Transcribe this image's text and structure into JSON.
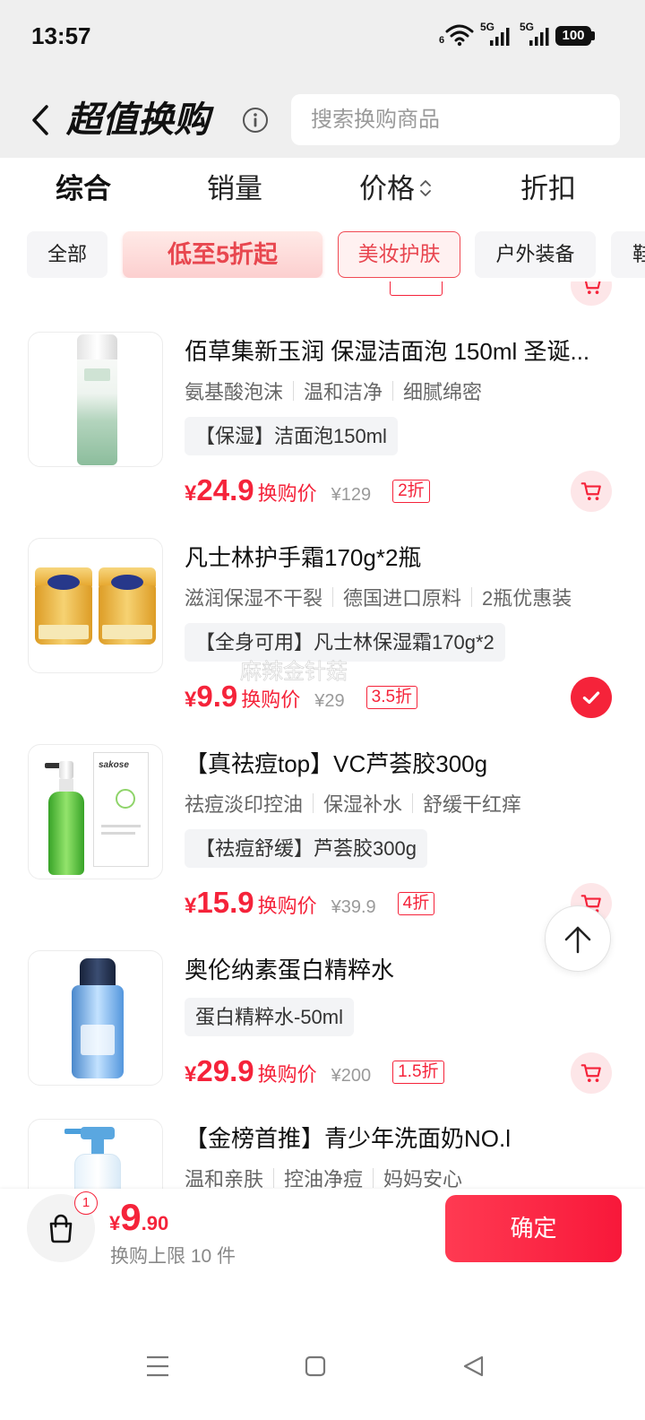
{
  "status_bar": {
    "time": "13:57",
    "wifi_label": "6",
    "signal_1_label": "5G",
    "signal_2_label": "5G",
    "battery": "100"
  },
  "header": {
    "title": "超值换购",
    "search_placeholder": "搜索换购商品"
  },
  "sort_tabs": [
    {
      "label": "综合",
      "active": true
    },
    {
      "label": "销量",
      "active": false
    },
    {
      "label": "价格",
      "active": false,
      "sortable": true
    },
    {
      "label": "折扣",
      "active": false
    }
  ],
  "filter_chips": [
    {
      "label": "全部",
      "selected": false
    },
    {
      "label": "低至5折起",
      "promo": true
    },
    {
      "label": "美妆护肤",
      "selected": true
    },
    {
      "label": "户外装备",
      "selected": false
    },
    {
      "label": "鞋",
      "selected": false
    }
  ],
  "currency": "¥",
  "price_label": "换购价",
  "products": [
    {
      "title": "佰草集新玉润 保湿洁面泡 150ml 圣诞...",
      "tags": [
        "氨基酸泡沫",
        "温和洁净",
        "细腻绵密"
      ],
      "spec": "【保湿】洁面泡150ml",
      "price": "24.9",
      "original_price": "¥129",
      "discount": "2折",
      "selected": false,
      "action_icon": "cart-icon"
    },
    {
      "title": "凡士林护手霜170g*2瓶",
      "tags": [
        "滋润保湿不干裂",
        "德国进口原料",
        "2瓶优惠装"
      ],
      "spec": "【全身可用】凡士林保湿霜170g*2",
      "price": "9.9",
      "original_price": "¥29",
      "discount": "3.5折",
      "selected": true,
      "action_icon": "check-icon"
    },
    {
      "title": "【真祛痘top】VC芦荟胶300g",
      "tags": [
        "祛痘淡印控油",
        "保湿补水",
        "舒缓干红痒"
      ],
      "spec": "【祛痘舒缓】芦荟胶300g",
      "price": "15.9",
      "original_price": "¥39.9",
      "discount": "4折",
      "selected": false,
      "action_icon": "cart-icon",
      "image_logo": "sakose"
    },
    {
      "title": "奥伦纳素蛋白精粹水",
      "tags": [],
      "spec": "蛋白精粹水-50ml",
      "price": "29.9",
      "original_price": "¥200",
      "discount": "1.5折",
      "selected": false,
      "action_icon": "cart-icon"
    },
    {
      "title": "【金榜首推】青少年洗面奶NO.l",
      "tags": [
        "温和亲肤",
        "控油净痘",
        "妈妈安心"
      ]
    }
  ],
  "watermark": "麻辣金针菇",
  "footer": {
    "selected_count_badge": "1",
    "price_currency": "¥",
    "price_integer": "9",
    "price_decimal": ".90",
    "limit_text": "换购上限 10 件",
    "confirm_label": "确定"
  },
  "colors": {
    "accent": "#f5233a",
    "header_bg": "#efefef",
    "chip_bg": "#f5f5f7",
    "spec_bg": "#f3f4f6",
    "cart_bg": "#fde6e8"
  },
  "icons": {
    "back": "chevron-left-icon",
    "info": "info-icon",
    "sort": "sort-updown-icon",
    "cart": "cart-icon",
    "selected": "check-icon",
    "scroll_top": "arrow-up-icon",
    "bag": "shopping-bag-icon",
    "nav": [
      "menu-icon",
      "home-square-icon",
      "back-triangle-icon"
    ]
  }
}
